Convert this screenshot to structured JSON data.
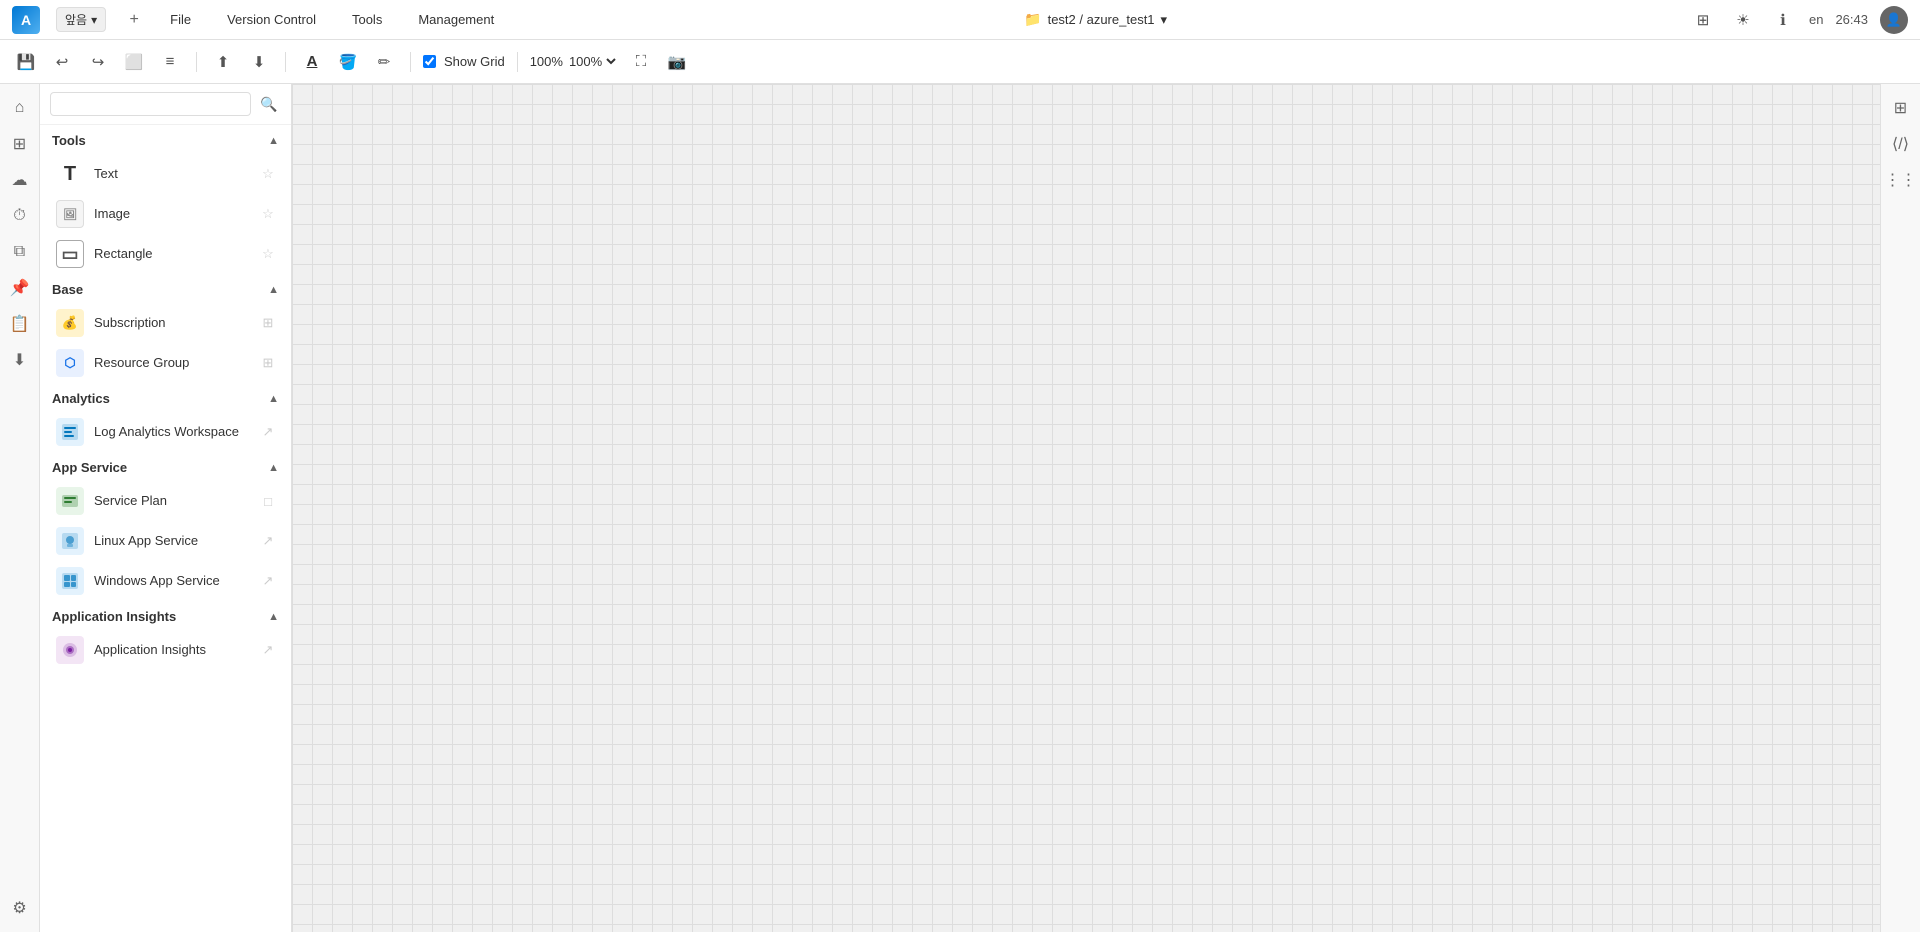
{
  "titleBar": {
    "menus": [
      "File",
      "Version Control",
      "Tools",
      "Management"
    ],
    "projectPath": "test2 / azure_test1",
    "language": "en",
    "time": "26:43"
  },
  "toolbar": {
    "checkboxLabel": "Show Grid",
    "zoomLevel": "100%",
    "tabName": "앞음"
  },
  "sidebar": {
    "searchPlaceholder": "",
    "sections": [
      {
        "id": "tools",
        "title": "Tools",
        "expanded": true,
        "items": [
          {
            "id": "text",
            "label": "Text",
            "iconType": "text",
            "actionIcon": "star"
          },
          {
            "id": "image",
            "label": "Image",
            "iconType": "image",
            "actionIcon": "star"
          },
          {
            "id": "rectangle",
            "label": "Rectangle",
            "iconType": "rectangle",
            "actionIcon": "star"
          }
        ]
      },
      {
        "id": "base",
        "title": "Base",
        "expanded": true,
        "items": [
          {
            "id": "subscription",
            "label": "Subscription",
            "iconType": "subscription",
            "actionIcon": "resize"
          },
          {
            "id": "resource-group",
            "label": "Resource Group",
            "iconType": "resource-group",
            "actionIcon": "resize"
          }
        ]
      },
      {
        "id": "analytics",
        "title": "Analytics",
        "expanded": true,
        "items": [
          {
            "id": "log-analytics",
            "label": "Log Analytics Workspace",
            "iconType": "log-analytics",
            "actionIcon": "expand"
          }
        ]
      },
      {
        "id": "app-service",
        "title": "App Service",
        "expanded": true,
        "items": [
          {
            "id": "service-plan",
            "label": "Service Plan",
            "iconType": "service-plan",
            "actionIcon": "square"
          },
          {
            "id": "linux-app",
            "label": "Linux App Service",
            "iconType": "linux-app",
            "actionIcon": "expand"
          },
          {
            "id": "windows-app",
            "label": "Windows App Service",
            "iconType": "windows-app",
            "actionIcon": "expand"
          }
        ]
      },
      {
        "id": "application-insights",
        "title": "Application Insights",
        "expanded": true,
        "items": [
          {
            "id": "app-insights",
            "label": "Application Insights",
            "iconType": "app-insights",
            "actionIcon": "expand"
          }
        ]
      }
    ]
  },
  "canvas": {
    "gridSize": 20
  },
  "iconBar": {
    "leftIcons": [
      "save",
      "undo",
      "redo",
      "layout",
      "list",
      "export",
      "import",
      "layer",
      "location",
      "download",
      "settings"
    ],
    "rightIcons": [
      "table",
      "sun",
      "info",
      "code",
      "grid"
    ]
  }
}
